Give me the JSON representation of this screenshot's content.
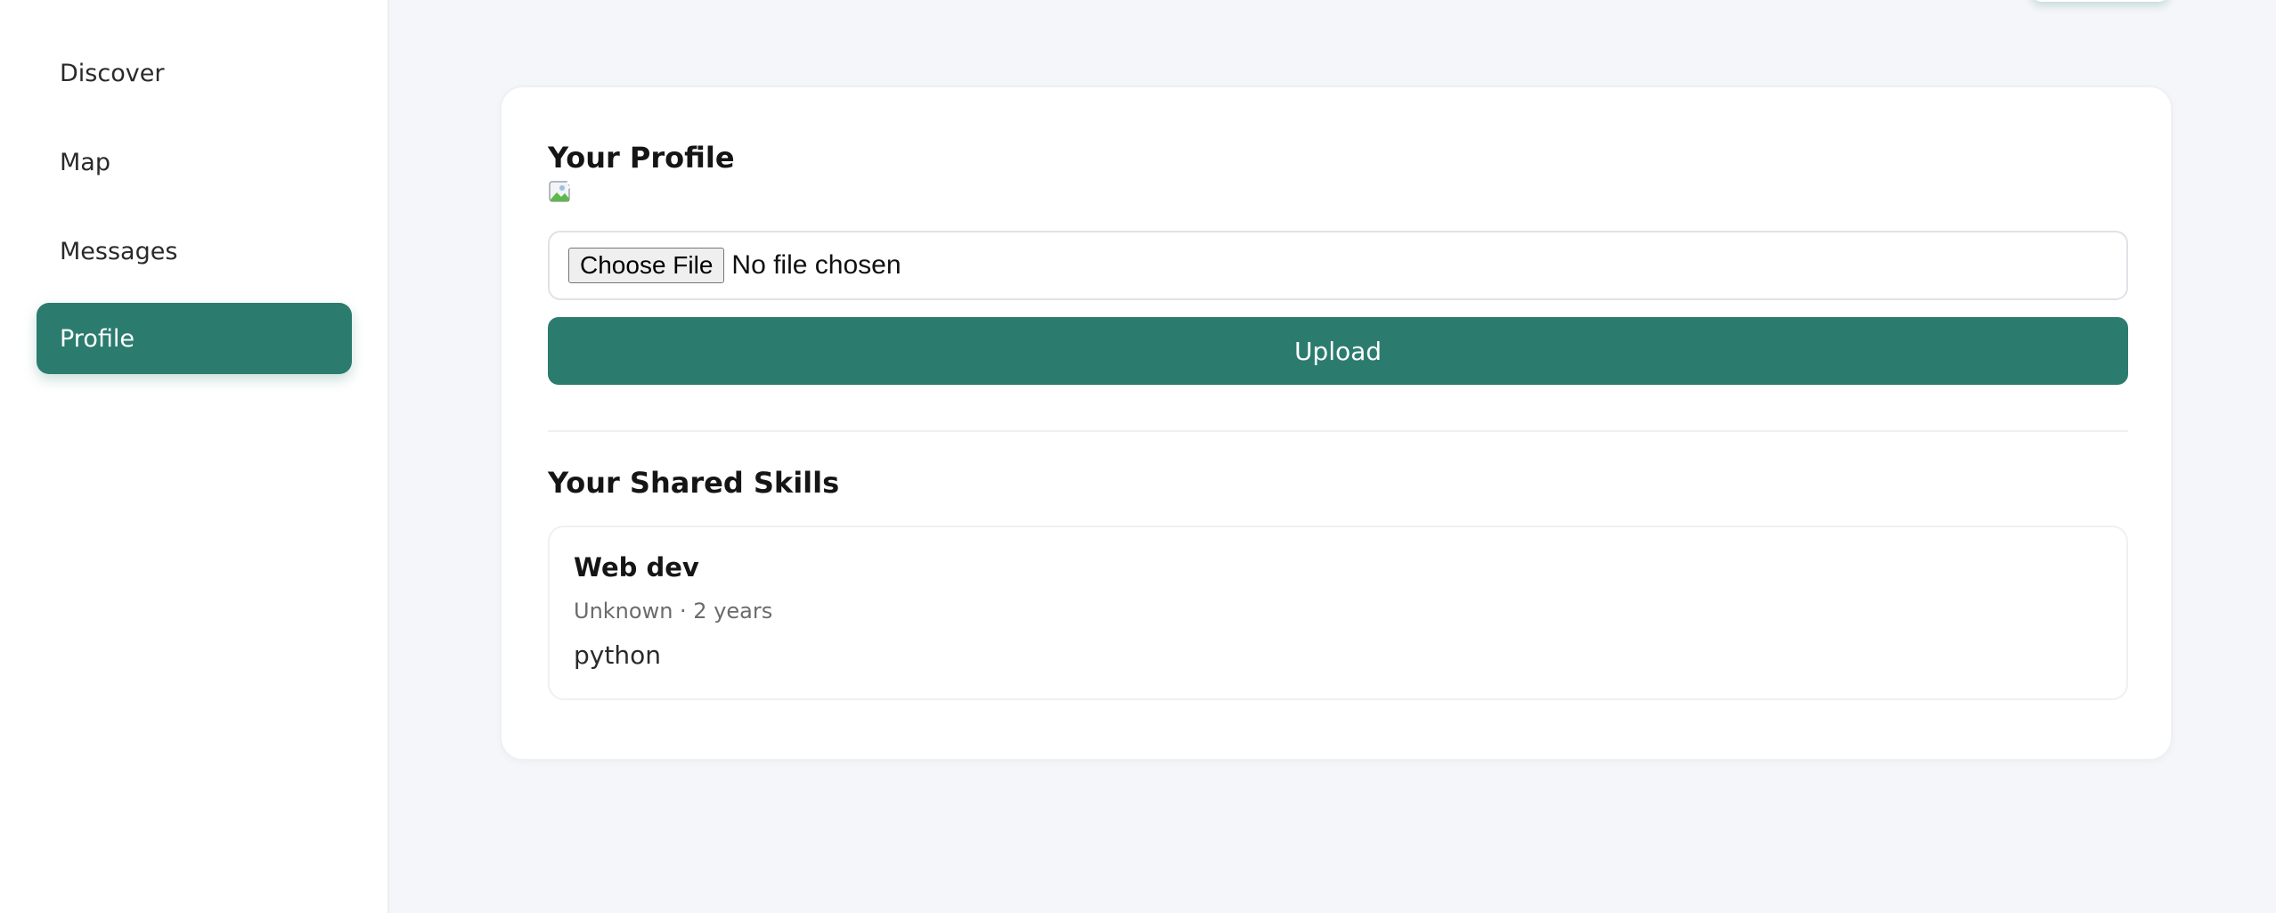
{
  "sidebar": {
    "items": [
      {
        "label": "Discover",
        "active": false
      },
      {
        "label": "Map",
        "active": false
      },
      {
        "label": "Messages",
        "active": false
      },
      {
        "label": "Profile",
        "active": true
      }
    ]
  },
  "profile": {
    "title": "Your Profile",
    "avatar_icon": "broken-image-icon",
    "file_input": {
      "button_label": "Choose File",
      "status": "No file chosen"
    },
    "upload_label": "Upload"
  },
  "skills": {
    "title": "Your Shared Skills",
    "items": [
      {
        "name": "Web dev",
        "meta": "Unknown · 2 years",
        "description": "python"
      }
    ]
  },
  "colors": {
    "accent": "#2b7c6e",
    "background": "#f5f6f9",
    "surface": "#ffffff"
  }
}
